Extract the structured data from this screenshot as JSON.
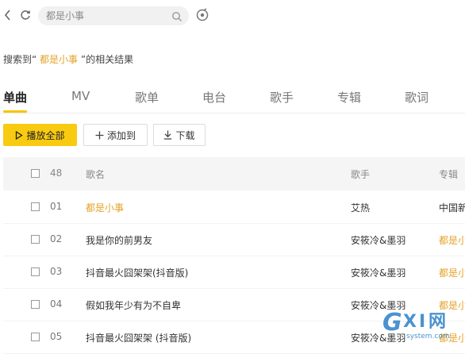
{
  "search": {
    "value": "",
    "placeholder": "都是小事"
  },
  "result": {
    "prefix": "搜索到“",
    "keyword": "都是小事",
    "suffix": "”的相关结果"
  },
  "tabs": [
    {
      "label": "单曲",
      "active": true
    },
    {
      "label": "MV"
    },
    {
      "label": "歌单"
    },
    {
      "label": "电台"
    },
    {
      "label": "歌手"
    },
    {
      "label": "专辑"
    },
    {
      "label": "歌词"
    }
  ],
  "actions": {
    "play_all": "播放全部",
    "add_to": "添加到",
    "download": "下载"
  },
  "table": {
    "count": "48",
    "col_song": "歌名",
    "col_artist": "歌手",
    "col_album": "专辑",
    "rows": [
      {
        "num": "01",
        "title": "都是小事",
        "artist": "艾热",
        "album": "中国新"
      },
      {
        "num": "02",
        "title": "我是你的前男友",
        "artist": "安筱冷&墨羽",
        "album": "都是小"
      },
      {
        "num": "03",
        "title": "抖音最火囧架架(抖音版)",
        "artist": "安筱冷&墨羽",
        "album": "都是小"
      },
      {
        "num": "04",
        "title": "假如我年少有为不自卑",
        "artist": "安筱冷&墨羽",
        "album": "都是小"
      },
      {
        "num": "05",
        "title": "抖音最火囧架架 (抖音版)",
        "artist": "安筱冷&墨羽",
        "album": "都是小"
      }
    ]
  },
  "colors": {
    "accent": "#f8cb11",
    "highlight": "#e4a32a"
  },
  "watermark": {
    "text": "GXI网",
    "sub": "system.com"
  }
}
